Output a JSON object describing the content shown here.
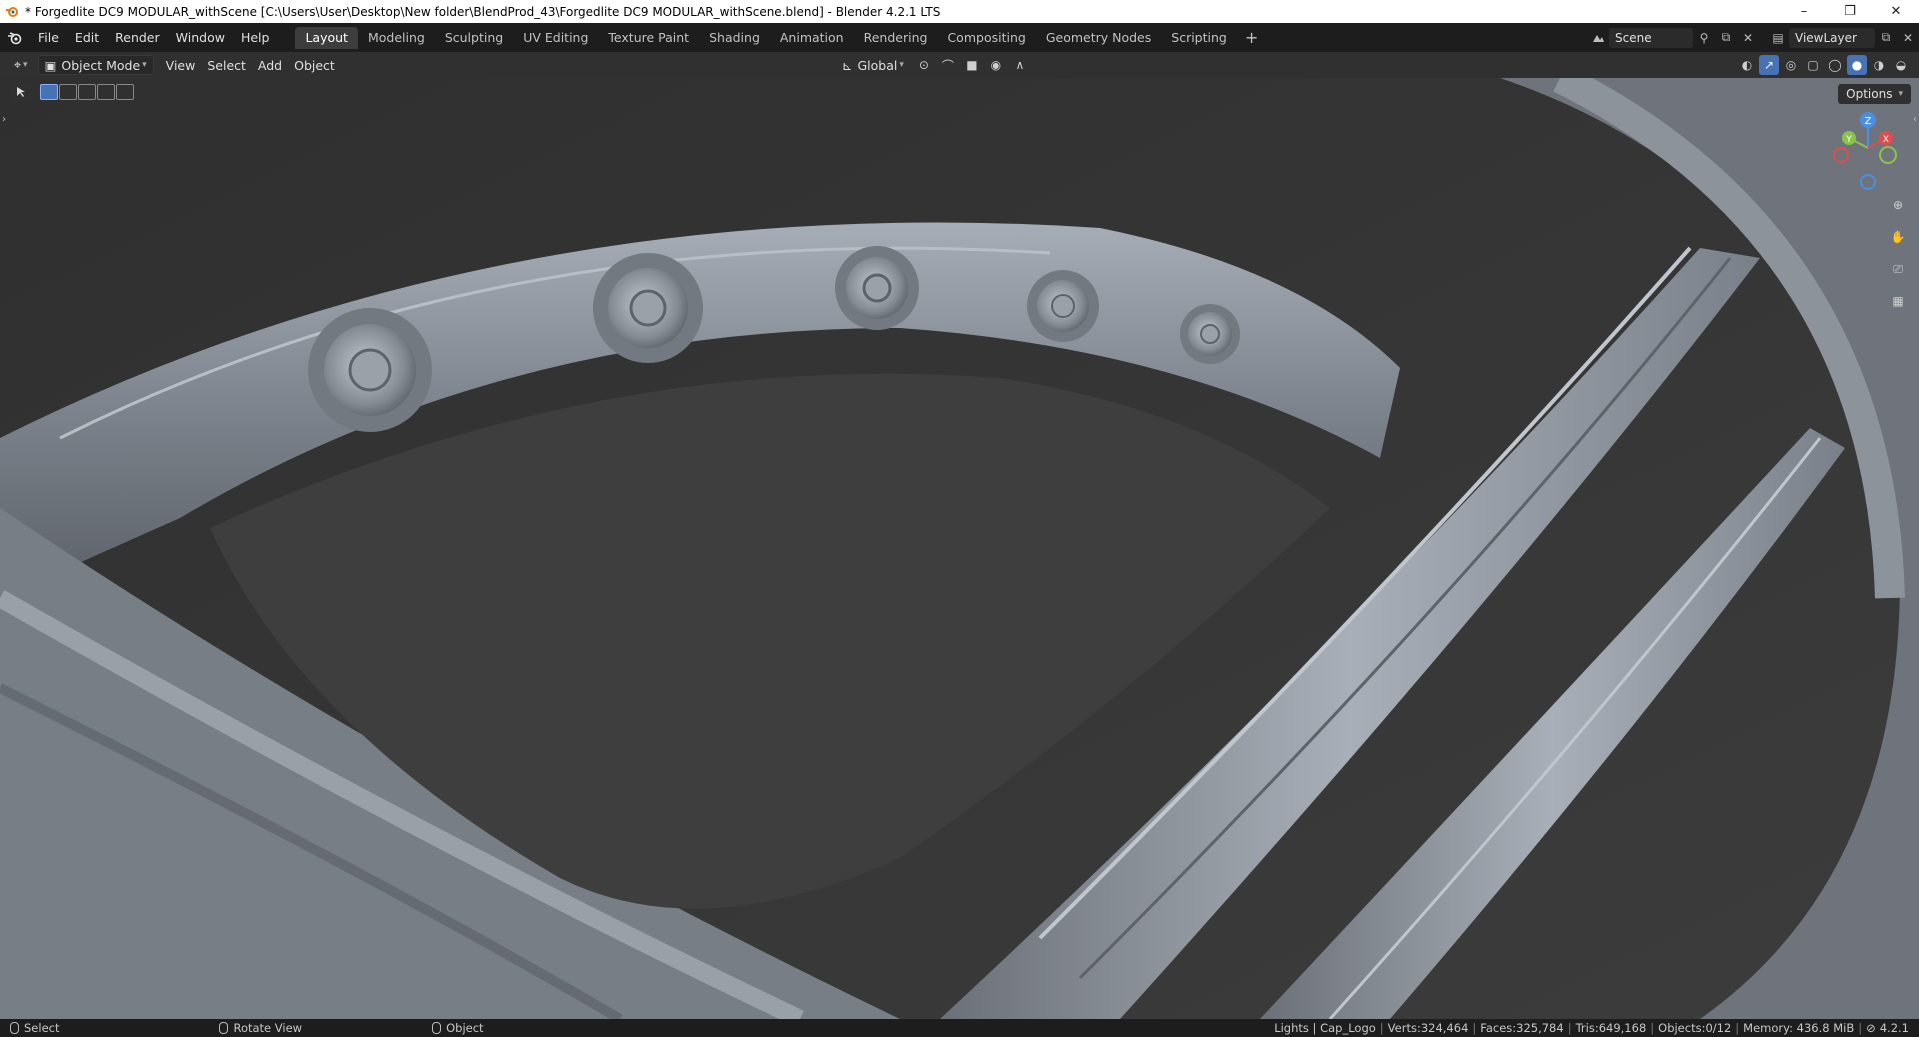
{
  "window": {
    "title": "* Forgedlite DC9 MODULAR_withScene [C:\\Users\\User\\Desktop\\New folder\\BlendProd_43\\Forgedlite DC9 MODULAR_withScene.blend] - Blender 4.2.1 LTS",
    "controls": {
      "minimize": "–",
      "maximize": "❐",
      "close": "✕"
    }
  },
  "menubar": {
    "items": [
      "File",
      "Edit",
      "Render",
      "Window",
      "Help"
    ]
  },
  "workspaces": {
    "tabs": [
      "Layout",
      "Modeling",
      "Sculpting",
      "UV Editing",
      "Texture Paint",
      "Shading",
      "Animation",
      "Rendering",
      "Compositing",
      "Geometry Nodes",
      "Scripting"
    ],
    "active": "Layout",
    "add_label": "+"
  },
  "scene": {
    "name": "Scene",
    "view_layer": "ViewLayer"
  },
  "viewport_header": {
    "mode": "Object Mode",
    "menus": [
      "View",
      "Select",
      "Add",
      "Object"
    ],
    "transform_orientation": "Global"
  },
  "viewport": {
    "options_label": "Options",
    "gizmo": {
      "z_label": "Z",
      "y_label": "Y",
      "x_label": "X"
    }
  },
  "statusbar": {
    "left": [
      {
        "label": "Select",
        "icon": "mouse-left-icon"
      },
      {
        "label": "Rotate View",
        "icon": "mouse-middle-icon"
      },
      {
        "label": "Object",
        "icon": "mouse-right-icon"
      }
    ],
    "stats": {
      "collection": "Lights | Cap_Logo",
      "verts": "Verts:324,464",
      "faces": "Faces:325,784",
      "tris": "Tris:649,168",
      "objects": "Objects:0/12",
      "memory": "Memory: 436.8 MiB",
      "version": "4.2.1"
    }
  },
  "colors": {
    "accent": "#4772b3",
    "topbar_bg": "#1d1d1d",
    "header_bg": "#303030",
    "axis_x": "#e14d4d",
    "axis_y": "#8bc34a",
    "axis_z": "#4a8fe0"
  }
}
